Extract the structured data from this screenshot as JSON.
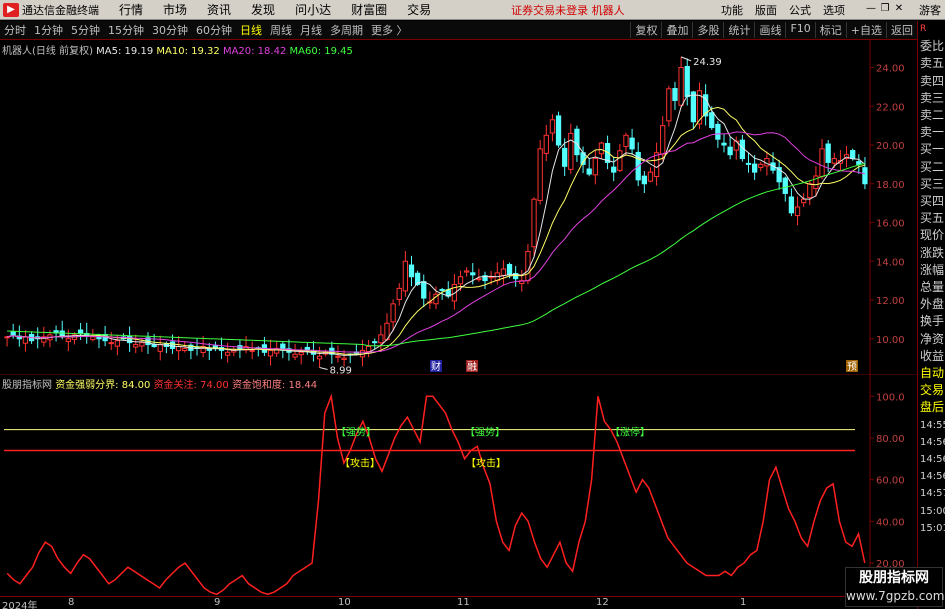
{
  "menubar": {
    "app_title": "通达信金融终端",
    "items": [
      "行情",
      "市场",
      "资讯",
      "发现",
      "问小达",
      "财富圈",
      "交易"
    ],
    "warning": "证券交易未登录 机器人",
    "right_items": [
      "功能",
      "版面",
      "公式",
      "选项"
    ],
    "guest": "游客"
  },
  "periodbar": {
    "items": [
      "分时",
      "1分钟",
      "5分钟",
      "15分钟",
      "30分钟",
      "60分钟",
      "日线",
      "周线",
      "月线",
      "多周期",
      "更多 〉"
    ],
    "active": "日线",
    "tools": [
      "复权",
      "叠加",
      "多股",
      "统计",
      "画线",
      "F10",
      "标记",
      "+自选",
      "返回"
    ]
  },
  "main_legend": {
    "title": "机器人(日线 前复权)",
    "ma5": "MA5: 19.19",
    "ma10": "MA10: 19.32",
    "ma20": "MA20: 18.42",
    "ma60": "MA60: 19.45"
  },
  "price_axis": {
    "labels": [
      "24.00",
      "22.00",
      "20.00",
      "18.00",
      "16.00",
      "14.00",
      "12.00",
      "10.00"
    ],
    "values": [
      24,
      22,
      20,
      18,
      16,
      14,
      12,
      10
    ],
    "high_label": "24.39",
    "low_label": "8.99",
    "badges": [
      "财",
      "融",
      "预"
    ]
  },
  "indicator_legend": {
    "name": "股朋指标网",
    "line1": "资金强弱分界: 84.00",
    "line2": "资金关注: 74.00",
    "line3": "资金饱和度: 18.44"
  },
  "indicator_axis": {
    "labels": [
      "100.0",
      "80.00",
      "60.00",
      "40.00",
      "20.00"
    ],
    "values": [
      100,
      80,
      60,
      40,
      20
    ],
    "signal_labels": [
      "【强势】",
      "【攻击】",
      "【强势】",
      "【攻击】",
      "【涨停】"
    ]
  },
  "date_axis": {
    "labels": [
      "2024年",
      "8",
      "9",
      "10",
      "11",
      "12",
      "1"
    ]
  },
  "right_panel": {
    "items": [
      "R",
      "委比",
      "卖五",
      "卖四",
      "卖三",
      "卖二",
      "卖一",
      "买一",
      "买二",
      "买三",
      "买四",
      "买五",
      "现价",
      "涨跌",
      "涨幅",
      "总量",
      "外盘",
      "换手",
      "净资",
      "收益",
      "自动",
      "交易",
      "盘后",
      "14:55",
      "14:56",
      "14:56",
      "14:56",
      "14:57",
      "15:00",
      "15:01"
    ]
  },
  "watermark": {
    "line1": "股朋指标网",
    "line2": "www.7gpzb.com"
  },
  "colors": {
    "up": "#ff3232",
    "down": "#54ffff",
    "ma5": "#e6e6e6",
    "ma10": "#ffff66",
    "ma20": "#e040e0",
    "ma60": "#40ff40",
    "indicator": "#ff2020",
    "threshold_84": "#ffff80",
    "threshold_74": "#ff2020"
  },
  "chart_data": {
    "type": "candlestick",
    "close": [
      10.1,
      10.2,
      10.0,
      10.1,
      9.9,
      10.0,
      10.1,
      10.2,
      10.3,
      10.1,
      10.0,
      10.2,
      10.3,
      10.2,
      10.1,
      10.0,
      9.9,
      9.8,
      9.9,
      10.0,
      9.8,
      9.7,
      9.8,
      9.7,
      9.6,
      9.7,
      9.6,
      9.5,
      9.6,
      9.5,
      9.4,
      9.5,
      9.6,
      9.4,
      9.5,
      9.4,
      9.3,
      9.4,
      9.5,
      9.6,
      9.4,
      9.5,
      9.3,
      9.4,
      9.5,
      9.4,
      9.3,
      9.2,
      9.3,
      9.4,
      9.2,
      9.1,
      9.3,
      9.2,
      9.1,
      9.0,
      9.2,
      9.3,
      9.4,
      9.6,
      9.8,
      10.2,
      10.8,
      11.8,
      12.6,
      14.0,
      13.2,
      12.8,
      12.1,
      11.9,
      12.3,
      12.5,
      12.2,
      12.8,
      13.2,
      13.5,
      13.3,
      13.1,
      13.0,
      13.2,
      13.4,
      13.6,
      13.3,
      13.1,
      13.0,
      14.5,
      17.2,
      19.8,
      20.5,
      21.3,
      20.0,
      18.9,
      20.6,
      19.5,
      19.0,
      18.5,
      19.3,
      20.1,
      19.1,
      18.6,
      19.7,
      20.5,
      19.8,
      18.2,
      18.0,
      18.6,
      19.6,
      21.0,
      22.9,
      22.3,
      24.0,
      22.5,
      21.2,
      22.8,
      21.5,
      20.9,
      20.3,
      20.0,
      19.5,
      20.2,
      19.3,
      19.0,
      18.6,
      19.0,
      19.3,
      18.7,
      18.1,
      17.5,
      16.5,
      16.8,
      17.2,
      18.0,
      18.4,
      19.8,
      19.1,
      19.3,
      19.2,
      19.5,
      19.3,
      19.0,
      18.0
    ],
    "ma60_start": 10.4,
    "indicator_values": [
      15,
      12,
      10,
      14,
      18,
      25,
      30,
      28,
      22,
      18,
      15,
      20,
      24,
      22,
      18,
      14,
      10,
      12,
      15,
      18,
      16,
      14,
      12,
      10,
      8,
      12,
      15,
      18,
      20,
      16,
      12,
      8,
      6,
      5,
      7,
      10,
      12,
      14,
      10,
      8,
      6,
      5,
      6,
      8,
      10,
      14,
      16,
      18,
      20,
      50,
      92,
      100,
      80,
      68,
      74,
      82,
      88,
      80,
      70,
      64,
      72,
      80,
      86,
      90,
      84,
      78,
      100,
      100,
      96,
      92,
      84,
      78,
      70,
      74,
      76,
      66,
      58,
      40,
      30,
      26,
      38,
      44,
      40,
      30,
      22,
      18,
      24,
      30,
      20,
      16,
      30,
      40,
      60,
      100,
      88,
      84,
      78,
      70,
      62,
      54,
      60,
      56,
      48,
      40,
      32,
      28,
      24,
      20,
      18,
      16,
      14,
      14,
      14,
      16,
      14,
      18,
      20,
      24,
      26,
      40,
      60,
      66,
      56,
      46,
      40,
      32,
      28,
      40,
      50,
      56,
      58,
      40,
      30,
      28,
      34,
      20
    ],
    "thresholds": [
      84,
      74
    ]
  }
}
